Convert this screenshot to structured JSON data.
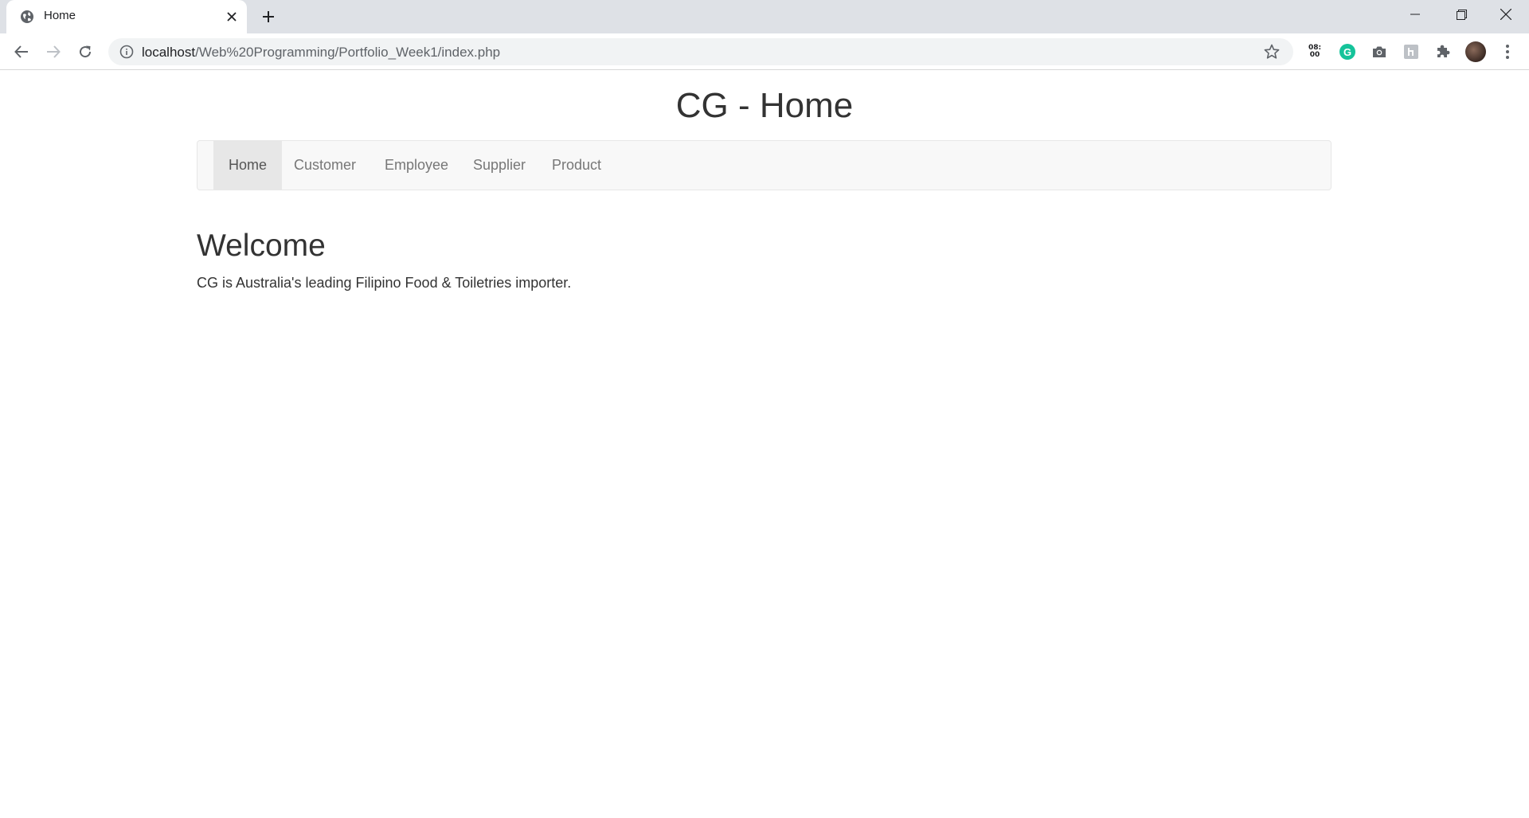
{
  "browser": {
    "tab": {
      "title": "Home",
      "favicon": "globe-icon"
    },
    "url": {
      "host": "localhost",
      "path": "/Web%20Programming/Portfolio_Week1/index.php"
    },
    "extensions": {
      "clock": {
        "line1": "08:",
        "line2": "00"
      },
      "grammarly": {
        "letter": "G",
        "color": "#15c39a"
      }
    }
  },
  "page": {
    "title": "CG - Home",
    "nav": [
      {
        "label": "Home",
        "active": true
      },
      {
        "label": "Customer",
        "active": false
      },
      {
        "label": "Employee",
        "active": false
      },
      {
        "label": "Supplier",
        "active": false
      },
      {
        "label": "Product",
        "active": false
      }
    ],
    "heading": "Welcome",
    "intro": "CG is Australia's leading Filipino Food & Toiletries importer."
  },
  "colors": {
    "text": "#333333",
    "nav_text": "#777777",
    "nav_active_bg": "#e7e7e7",
    "navbar_bg": "#f8f8f8",
    "chrome_bg": "#dee1e6"
  }
}
